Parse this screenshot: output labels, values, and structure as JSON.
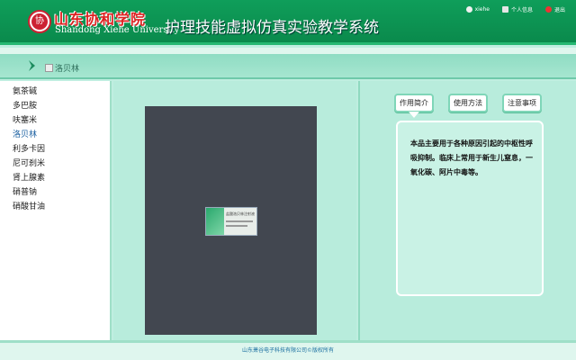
{
  "header": {
    "school_name_cn": "山东协和学院",
    "school_name_en": "Shandong Xiehe University",
    "system_title": "护理技能虚拟仿真实验教学系统",
    "user_links": [
      {
        "label": "xiehe",
        "icon": "user-icon",
        "color": "#f0f0f0"
      },
      {
        "label": "个人信息",
        "icon": "profile-icon",
        "color": "#e6e6e6"
      },
      {
        "label": "退出",
        "icon": "power-icon",
        "color": "#e33"
      }
    ]
  },
  "breadcrumb": {
    "current": "洛贝林"
  },
  "drug_list": {
    "items": [
      "氨茶碱",
      "多巴胺",
      "呋塞米",
      "洛贝林",
      "利多卡因",
      "尼可刹米",
      "肾上腺素",
      "硝普钠",
      "硝酸甘油"
    ],
    "active_index": 3
  },
  "viewer": {
    "image_label": "盐酸洛贝林注射液"
  },
  "tabs": [
    {
      "label": "作用简介",
      "active": true
    },
    {
      "label": "使用方法",
      "active": false
    },
    {
      "label": "注意事项",
      "active": false
    }
  ],
  "content": {
    "text": "本品主要用于各种原因引起的中枢性呼吸抑制。临床上常用于新生儿窒息，一氧化碳、阿片中毒等。"
  },
  "footer": {
    "copyright": "山东萧谷电子科技有限公司©版权所有"
  }
}
